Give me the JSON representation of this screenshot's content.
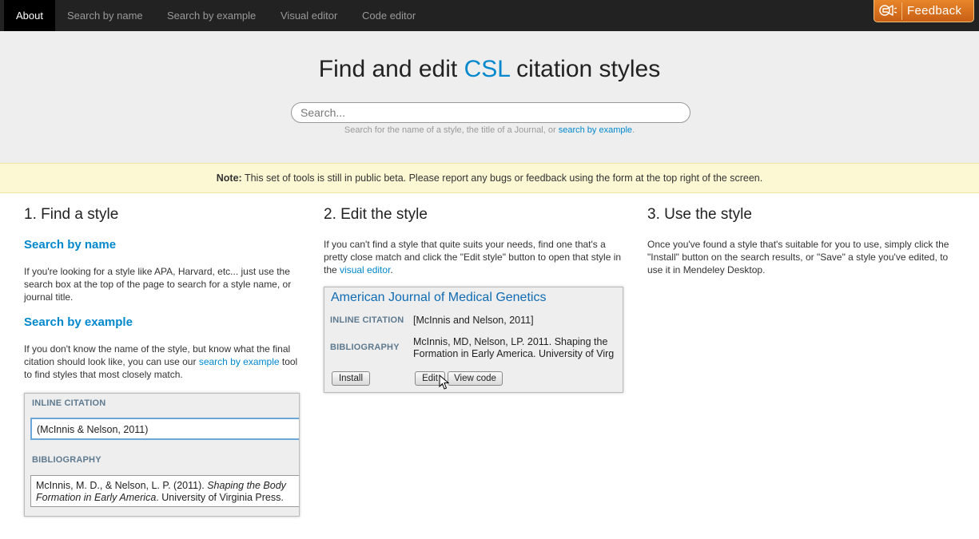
{
  "nav": {
    "items": [
      "About",
      "Search by name",
      "Search by example",
      "Visual editor",
      "Code editor"
    ],
    "feedback_label": "Feedback"
  },
  "hero": {
    "title_pre": "Find and edit",
    "title_accent": "CSL",
    "title_post": "citation styles",
    "search_placeholder": "Search...",
    "hint_pre": "Search for the name of a style, the title of a Journal, or",
    "hint_link": "search by example",
    "hint_post": "."
  },
  "note": {
    "label": "Note:",
    "text": "This set of tools is still in public beta. Please report any bugs or feedback using the form at the top right of the screen."
  },
  "find": {
    "heading": "1. Find a style",
    "by_name_heading": "Search by name",
    "by_name_text": "If you're looking for a style like APA, Harvard, etc... just use the search box at the top of the page to search for a style name, or journal title.",
    "by_example_heading": "Search by example",
    "by_example_pre": "If you don't know the name of the style, but know what the final citation should look like, you can use our",
    "by_example_link": "search by example",
    "by_example_post": "tool to find styles that most closely match.",
    "panel": {
      "inline_label": "INLINE CITATION",
      "inline_value": "(McInnis & Nelson, 2011)",
      "bib_label": "BIBLIOGRAPHY",
      "bib_plain1": "McInnis, M. D., & Nelson, L. P. (2011).",
      "bib_italic1": "Shaping the Body",
      "bib_italic2": "Formation in Early America",
      "bib_plain2": ". University of Virginia Press."
    }
  },
  "edit": {
    "heading": "2. Edit the style",
    "text_pre": "If you can't find a style that quite suits your needs, find one that's a pretty close match and click the \"Edit style\" button to open that style in the",
    "text_link": "visual editor",
    "text_post": ".",
    "card": {
      "journal_title": "American Journal of Medical Genetics",
      "inline_label": "INLINE CITATION",
      "inline_value": "[McInnis and Nelson, 2011]",
      "bib_label": "BIBLIOGRAPHY",
      "bib_line1": "McInnis, MD, Nelson, LP. 2011. Shaping the",
      "bib_line2": "Formation in Early America. University of Virg",
      "install_label": "Install",
      "edit_label": "Edit",
      "view_code_label": "View code"
    }
  },
  "use": {
    "heading": "3. Use the style",
    "text": "Once you've found a style that's suitable for you to use, simply click the \"Install\" button on the search results, or \"Save\" a style you've edited, to use it in Mendeley Desktop."
  }
}
